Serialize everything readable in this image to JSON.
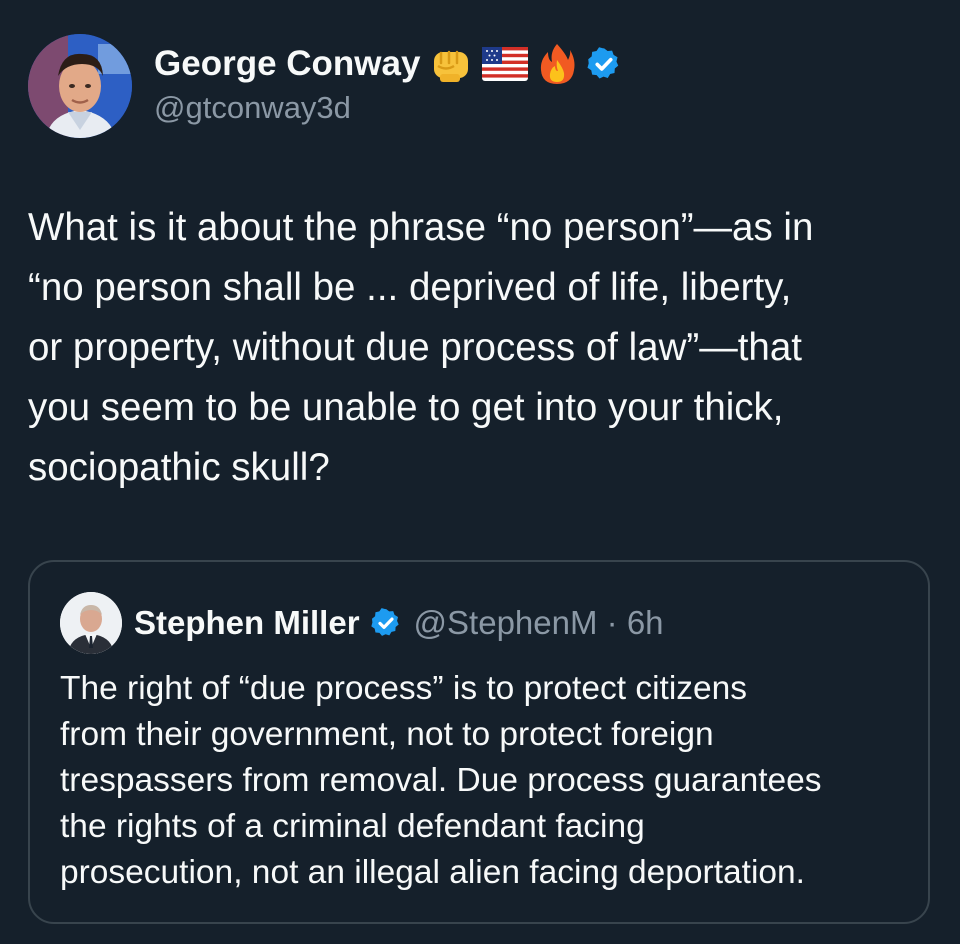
{
  "tweet": {
    "author": {
      "display_name": "George Conway",
      "handle": "@gtconway3d",
      "emoji_badges": [
        "fist-icon",
        "us-flag-icon",
        "fire-icon"
      ],
      "verified": true
    },
    "text_lines": [
      "What is it about the phrase “no person”—as in",
      "“no person shall be ... deprived of life, liberty,",
      "or property, without due process of law”—that",
      "you seem to be unable to get into your thick,",
      "sociopathic skull?"
    ]
  },
  "quote": {
    "author": {
      "display_name": "Stephen Miller",
      "handle": "@StephenM",
      "time": "· 6h",
      "verified": true
    },
    "text_lines": [
      "The right of “due process” is to protect citizens",
      "from their government, not to protect foreign",
      "trespassers from removal. Due process guarantees",
      "the rights of a criminal defendant facing",
      "prosecution, not an illegal alien facing deportation."
    ]
  },
  "colors": {
    "background": "#15202b",
    "text": "#f7f9f9",
    "secondary": "#8b98a5",
    "verified": "#1d9bf0",
    "border": "#38444d"
  }
}
